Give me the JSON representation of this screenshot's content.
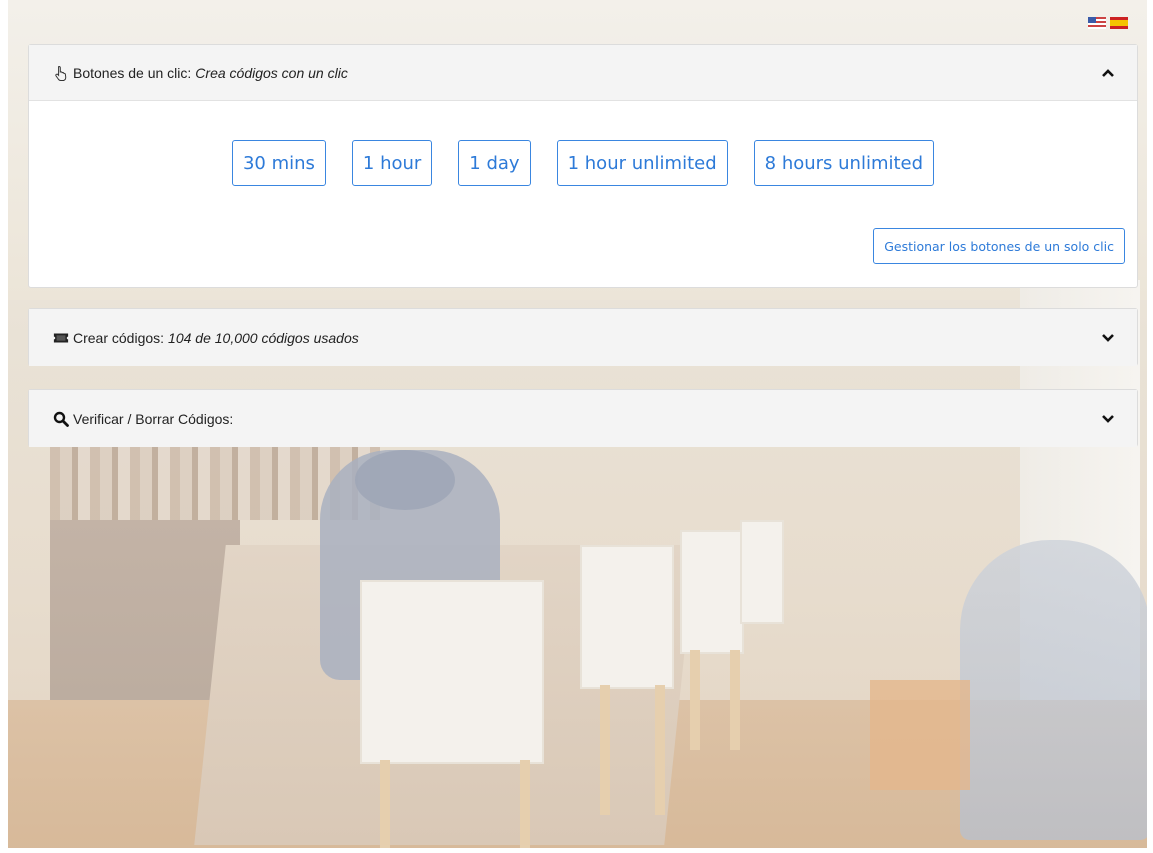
{
  "language_flags": [
    "us-flag-icon",
    "es-flag-icon"
  ],
  "one_click": {
    "title": "Botones de un clic:",
    "subtitle": "Crea códigos con un clic",
    "icon": "pointer-hand-icon",
    "expanded": true,
    "buttons": [
      "30 mins",
      "1 hour",
      "1 day",
      "1 hour unlimited",
      "8 hours unlimited"
    ],
    "manage_label": "Gestionar los botones de un solo clic"
  },
  "create": {
    "title": "Crear códigos:",
    "subtitle": "104 de 10,000 códigos usados",
    "icon": "ticket-icon",
    "expanded": false
  },
  "verify": {
    "title": "Verificar / Borrar Códigos:",
    "icon": "search-icon",
    "expanded": false
  },
  "colors": {
    "accent": "#2d7ad8",
    "panel_header": "#f4f4f4"
  }
}
